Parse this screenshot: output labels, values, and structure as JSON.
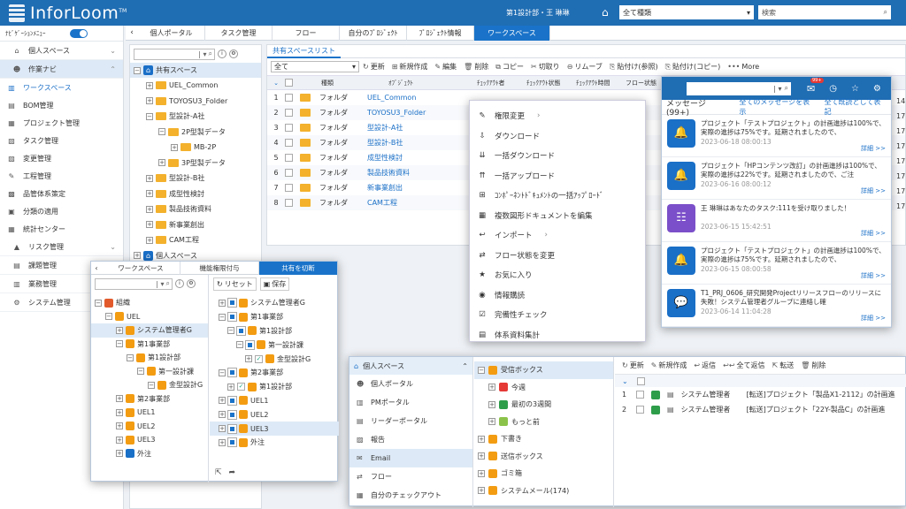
{
  "app": {
    "logo": "InforLoom",
    "tm": "TM",
    "user": "第1設計部・王 琳琳",
    "type_select": "全て種類",
    "search_placeholder": "検索"
  },
  "colors": {
    "header": "#1f6db3",
    "accent": "#1a6fc7",
    "folder": "#f3b12c",
    "active_tab": "#1a73c9"
  },
  "sidebar": {
    "toggle_label": "ﾅﾋﾞｹﾞｰｼｮﾝﾒﾆｭｰ",
    "items": [
      {
        "label": "個人スペース",
        "icon": "home-icon"
      },
      {
        "label": "作業ナビ",
        "icon": "person-icon"
      },
      {
        "label": "ワークスペース",
        "icon": "chart-icon"
      },
      {
        "label": "BOM管理",
        "icon": "bom-icon"
      },
      {
        "label": "プロジェクト管理",
        "icon": "project-icon"
      },
      {
        "label": "タスク管理",
        "icon": "task-icon"
      },
      {
        "label": "変更管理",
        "icon": "change-icon"
      },
      {
        "label": "工程管理",
        "icon": "process-icon"
      },
      {
        "label": "品管体系策定",
        "icon": "quality-icon"
      },
      {
        "label": "分類の適用",
        "icon": "classify-icon"
      },
      {
        "label": "統計センター",
        "icon": "stats-icon"
      },
      {
        "label": "リスク管理",
        "icon": "risk-icon"
      },
      {
        "label": "課題管理",
        "icon": "issue-icon"
      },
      {
        "label": "業務管理",
        "icon": "business-icon"
      },
      {
        "label": "システム管理",
        "icon": "gear-icon"
      }
    ]
  },
  "tabs": [
    "個人ポータル",
    "タスク管理",
    "フロー",
    "自分のﾌﾟﾛｼﾞｪｸﾄ",
    "ﾌﾟﾛｼﾞｪｸﾄ情報",
    "ワークスペース"
  ],
  "tree": {
    "root": "共有スペース",
    "items": [
      "UEL_Common",
      "TOYOSU3_Folder",
      "型設計-A社",
      "2P型製データ",
      "MB-2P",
      "3P型製データ",
      "型設計-B社",
      "成型性検討",
      "製品技術資料",
      "新事業創出",
      "CAM工程",
      "個人スペース"
    ]
  },
  "list": {
    "tab": "共有スペースリスト",
    "filter": "全て",
    "toolbar": [
      "更新",
      "新規作成",
      "編集",
      "削除",
      "コピー",
      "切取り",
      "リムーブ",
      "貼付け(参照)",
      "貼付け(コピー)",
      "More"
    ],
    "columns": [
      "種類",
      "ｵﾌﾞｼﾞｪｸﾄ",
      "ﾁｪｯｸｱｳﾄ者",
      "ﾁｪｯｸｱｳﾄ状態",
      "ﾁｪｯｸｱｳﾄ時間",
      "フロー状態"
    ],
    "rows": [
      {
        "no": "1",
        "type": "フォルダ",
        "name": "UEL_Common"
      },
      {
        "no": "2",
        "type": "フォルダ",
        "name": "TOYOSU3_Folder"
      },
      {
        "no": "3",
        "type": "フォルダ",
        "name": "型設計-A社"
      },
      {
        "no": "4",
        "type": "フォルダ",
        "name": "型設計-B社"
      },
      {
        "no": "5",
        "type": "フォルダ",
        "name": "成型性検討"
      },
      {
        "no": "6",
        "type": "フォルダ",
        "name": "製品技術資料"
      },
      {
        "no": "7",
        "type": "フォルダ",
        "name": "新事業創出"
      },
      {
        "no": "8",
        "type": "フォルダ",
        "name": "CAM工程"
      }
    ],
    "right_dates": [
      "14",
      "17",
      "17",
      "17",
      "17",
      "17",
      "17",
      "17"
    ]
  },
  "context_menu": [
    "権限変更",
    "ダウンロード",
    "一括ダウンロード",
    "一括アップロード",
    "ｺﾝﾎﾟｰﾈﾝﾄﾄﾞｷｭﾒﾝﾄの一括ｱｯﾌﾟﾛｰﾄﾞ",
    "複数図形ドキュメントを編集",
    "インポート",
    "フロー状態を変更",
    "お気に入り",
    "情報購読",
    "完備性チェック",
    "体系資料集計"
  ],
  "messages": {
    "badge": "99+",
    "title": "メッセージ (99+)",
    "show_all": "全てのメッセージを表示",
    "mark_read": "全て既読として表記",
    "detail": "詳細 >>",
    "items": [
      {
        "text": "プロジェクト「テストプロジェクト」の計画進捗は100%で、実際の進捗は75%です。延期されましたので、",
        "time": "2023-06-18 08:00:13",
        "color": "#1a6fc7"
      },
      {
        "text": "プロジェクト「HPコンテンツ改訂」の計画進捗は100%で、実際の進捗は22%です。延期されましたので、ご注",
        "time": "2023-06-16 08:00:12",
        "color": "#1a6fc7"
      },
      {
        "text": "王 琳琳はあなたのタスク:111を受け取りました！",
        "time": "2023-06-15 15:42:51",
        "color": "#7b4fc9"
      },
      {
        "text": "プロジェクト「テストプロジェクト」の計画進捗は100%で、実際の進捗は75%です。延期されましたので、",
        "time": "2023-06-15 08:00:58",
        "color": "#1a6fc7"
      },
      {
        "text": "T1_PRJ_0606_研究開発Projectリリースフローのリリースに失敗！システム管理者グループに連絡し確",
        "time": "2023-06-14 11:04:28",
        "color": "#1a6fc7"
      }
    ]
  },
  "perm": {
    "tabs": [
      "ワークスペース",
      "機能権限付与",
      "共有を切断"
    ],
    "reset": "リセット",
    "save": "保存",
    "left": [
      {
        "t": "組織",
        "d": 0,
        "c": "#e25a2b"
      },
      {
        "t": "UEL",
        "d": 1,
        "c": "#f39c12"
      },
      {
        "t": "システム管理者G",
        "d": 2,
        "c": "#f39c12"
      },
      {
        "t": "第1事業部",
        "d": 2,
        "c": "#f39c12"
      },
      {
        "t": "第1設計部",
        "d": 3,
        "c": "#f39c12"
      },
      {
        "t": "第一設計課",
        "d": 4,
        "c": "#f39c12"
      },
      {
        "t": "金型設計G",
        "d": 5,
        "c": "#f39c12"
      },
      {
        "t": "第2事業部",
        "d": 2,
        "c": "#f39c12"
      },
      {
        "t": "UEL1",
        "d": 2,
        "c": "#f39c12"
      },
      {
        "t": "UEL2",
        "d": 2,
        "c": "#f39c12"
      },
      {
        "t": "UEL3",
        "d": 2,
        "c": "#f39c12"
      },
      {
        "t": "外注",
        "d": 2,
        "c": "#1a6fc7"
      }
    ],
    "right": [
      {
        "t": "システム管理者G",
        "d": 1
      },
      {
        "t": "第1事業部",
        "d": 1
      },
      {
        "t": "第1設計部",
        "d": 2
      },
      {
        "t": "第一設計課",
        "d": 3
      },
      {
        "t": "金型設計G",
        "d": 4
      },
      {
        "t": "第2事業部",
        "d": 1
      },
      {
        "t": "第1設計部",
        "d": 2
      },
      {
        "t": "UEL1",
        "d": 1
      },
      {
        "t": "UEL2",
        "d": 1
      },
      {
        "t": "UEL3",
        "d": 1
      },
      {
        "t": "外注",
        "d": 1
      }
    ]
  },
  "mail": {
    "nav_title": "個人スペース",
    "nav": [
      "個人ポータル",
      "PMポータル",
      "リーダーポータル",
      "報告",
      "Email",
      "フロー",
      "自分のチェックアウト"
    ],
    "folders": [
      {
        "t": "受信ボックス",
        "d": 0
      },
      {
        "t": "今週",
        "d": 1
      },
      {
        "t": "最初の3週間",
        "d": 1
      },
      {
        "t": "もっと前",
        "d": 1
      },
      {
        "t": "下書き",
        "d": 0
      },
      {
        "t": "送信ボックス",
        "d": 0
      },
      {
        "t": "ゴミ箱",
        "d": 0
      },
      {
        "t": "システムメール(174)",
        "d": 0
      }
    ],
    "toolbar": [
      "更新",
      "新規作成",
      "返信",
      "全て返信",
      "転送",
      "削除"
    ],
    "rows": [
      {
        "no": "1",
        "from": "システム管理者",
        "subj": "[転送]プロジェクト「製品X1-2112」の計画進"
      },
      {
        "no": "2",
        "from": "システム管理者",
        "subj": "[転送]プロジェクト「22Y-製品C」の計画進"
      }
    ]
  }
}
